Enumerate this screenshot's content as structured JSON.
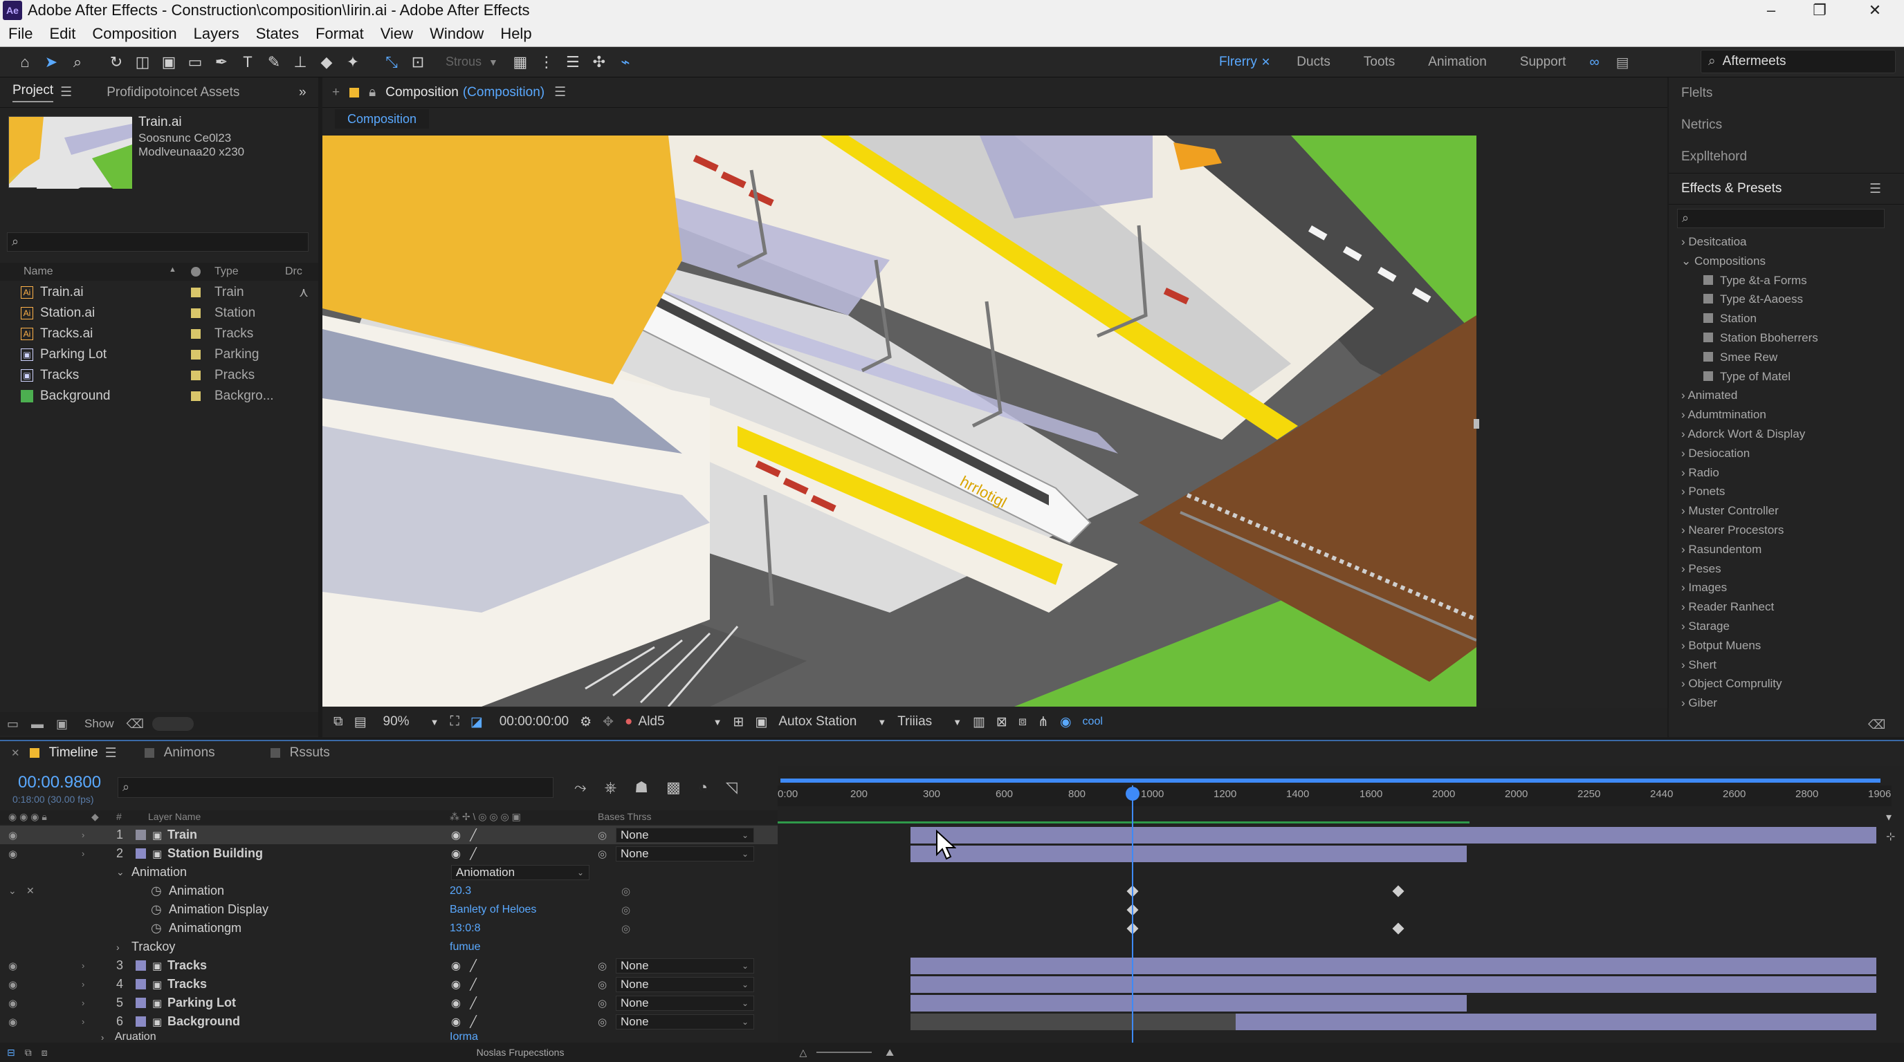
{
  "window": {
    "title": "Adobe After Effects - Construction\\composition\\Iirin.ai - Adobe After Effects",
    "logo": "Ae"
  },
  "menu": [
    "File",
    "Edit",
    "Composition",
    "Layers",
    "States",
    "Format",
    "View",
    "Window",
    "Help"
  ],
  "toolbar": {
    "snapping_label": "Strous",
    "workspaces": [
      {
        "label": "Flrerry",
        "active": true
      },
      {
        "label": "Ducts",
        "active": false
      },
      {
        "label": "Toots",
        "active": false
      },
      {
        "label": "Animation",
        "active": false
      },
      {
        "label": "Support",
        "active": false
      }
    ],
    "search_value": "Aftermeets"
  },
  "project": {
    "tabs": [
      "Project",
      "Profidipotoincet Assets"
    ],
    "selected_file": "Train.ai",
    "meta_line1": "Soosnunc Ce0l23",
    "meta_line2": "Modlveunaa20 x230",
    "columns": {
      "name": "Name",
      "type": "Type",
      "extra": "Drc"
    },
    "items": [
      {
        "name": "Train.ai",
        "type": "Train",
        "icon": "ai-file-icon"
      },
      {
        "name": "Station.ai",
        "type": "Station",
        "icon": "ai-file-icon"
      },
      {
        "name": "Tracks.ai",
        "type": "Tracks",
        "icon": "ai-file-icon"
      },
      {
        "name": "Parking Lot",
        "type": "Parking",
        "icon": "composition-icon"
      },
      {
        "name": "Tracks",
        "type": "Pracks",
        "icon": "composition-icon"
      },
      {
        "name": "Background",
        "type": "Backgro...",
        "icon": "solid-icon"
      }
    ],
    "footer_label": "Show"
  },
  "composition": {
    "tab_label": "Composition",
    "tab_sublabel": "(Composition)",
    "subtab": "Composition",
    "zoom": "90%",
    "timecode": "00:00:00:00",
    "resolution": "Ald5",
    "camera": "Autox Station",
    "views": "Triiias",
    "extra": "cool",
    "train_sign": "hrrlotigl"
  },
  "effects": {
    "top_items": [
      "Flelts",
      "Netrics",
      "Explltehord"
    ],
    "title": "Effects & Presets",
    "tree": [
      {
        "label": "Desitcatioa",
        "child": false
      },
      {
        "label": "Compositions",
        "child": false,
        "open": true
      },
      {
        "label": "Type &t-a Forms",
        "child": true
      },
      {
        "label": "Type &t-Aaoess",
        "child": true
      },
      {
        "label": "Station",
        "child": true
      },
      {
        "label": "Station Bboherrers",
        "child": true
      },
      {
        "label": "Smee Rew",
        "child": true
      },
      {
        "label": "Type of Matel",
        "child": true
      },
      {
        "label": "Animated",
        "child": false
      },
      {
        "label": "Adumtmination",
        "child": false
      },
      {
        "label": "Adorck Wort & Display",
        "child": false
      },
      {
        "label": "Desiocation",
        "child": false
      },
      {
        "label": "Radio",
        "child": false
      },
      {
        "label": "Ponets",
        "child": false
      },
      {
        "label": "Muster Controller",
        "child": false
      },
      {
        "label": "Nearer Procestors",
        "child": false
      },
      {
        "label": "Rasundentom",
        "child": false
      },
      {
        "label": "Peses",
        "child": false
      },
      {
        "label": "Images",
        "child": false
      },
      {
        "label": "Reader Ranhect",
        "child": false
      },
      {
        "label": "Starage",
        "child": false
      },
      {
        "label": "Botput Muens",
        "child": false
      },
      {
        "label": "Shert",
        "child": false
      },
      {
        "label": "Object Comprulity",
        "child": false
      },
      {
        "label": "Giber",
        "child": false
      }
    ]
  },
  "timeline": {
    "tabs": [
      "Timeline",
      "Animons",
      "Rssuts"
    ],
    "timecode": "00:00.9800",
    "timecode_sub": "0:18:00 (30.00 fps)",
    "col_layer": "Layer Name",
    "col_parent": "Bases Thrss",
    "col_num": "#",
    "ruler": [
      "0:00",
      "200",
      "300",
      "600",
      "800",
      "1000",
      "1200",
      "1400",
      "1600",
      "2000",
      "2000",
      "2250",
      "2440",
      "2600",
      "2800",
      "1906"
    ],
    "layers": [
      {
        "num": "1",
        "name": "Train",
        "parent": "None",
        "selected": true
      },
      {
        "num": "2",
        "name": "Station Building",
        "parent": "None",
        "selected": false
      }
    ],
    "animation_group": "Animation",
    "animation_dropdown": "Aniomation",
    "props": [
      {
        "name": "Animation",
        "value": "20.3"
      },
      {
        "name": "Animation Display",
        "value": "Banlety of Heloes"
      },
      {
        "name": "Animationgm",
        "value": "13:0:8"
      }
    ],
    "trackoy": {
      "name": "Trackoy",
      "value": "fumue"
    },
    "layers2": [
      {
        "num": "3",
        "name": "Tracks",
        "parent": "None"
      },
      {
        "num": "4",
        "name": "Tracks",
        "parent": "None"
      },
      {
        "num": "5",
        "name": "Parking Lot",
        "parent": "None"
      },
      {
        "num": "6",
        "name": "Background",
        "parent": "None"
      }
    ],
    "last_group": {
      "name": "Aruation",
      "value": "Iorma"
    },
    "footer_label": "Noslas Frupecstions"
  },
  "colors": {
    "accent": "#3e8af7",
    "layer_bar": "#8585b6",
    "yellow_roof": "#f0b830",
    "grass": "#6cbf3a"
  }
}
